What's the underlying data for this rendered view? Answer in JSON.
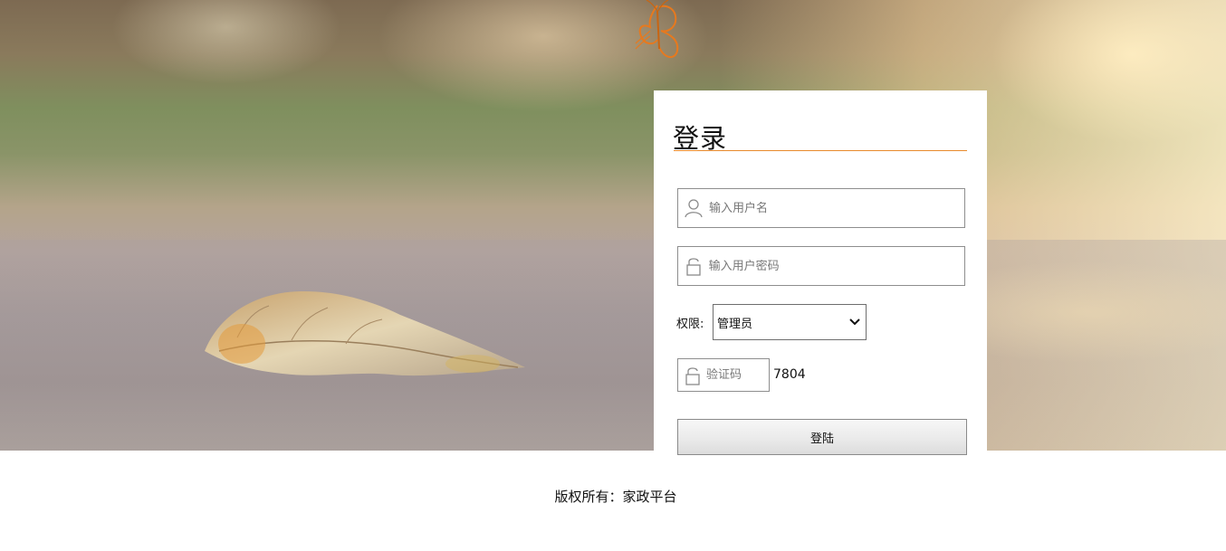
{
  "login": {
    "title": "登录",
    "username_placeholder": "输入用户名",
    "password_placeholder": "输入用户密码",
    "role_label": "权限:",
    "role_selected": "管理员",
    "captcha_placeholder": "验证码",
    "captcha_code": "7804",
    "submit_label": "登陆"
  },
  "footer": {
    "copyright": "版权所有：家政平台"
  },
  "icons": {
    "username": "user-icon",
    "password": "lock-icon",
    "captcha": "lock-icon",
    "select": "chevron-down-icon",
    "logo": "butterfly-logo"
  },
  "colors": {
    "accent": "#e88a2d"
  }
}
